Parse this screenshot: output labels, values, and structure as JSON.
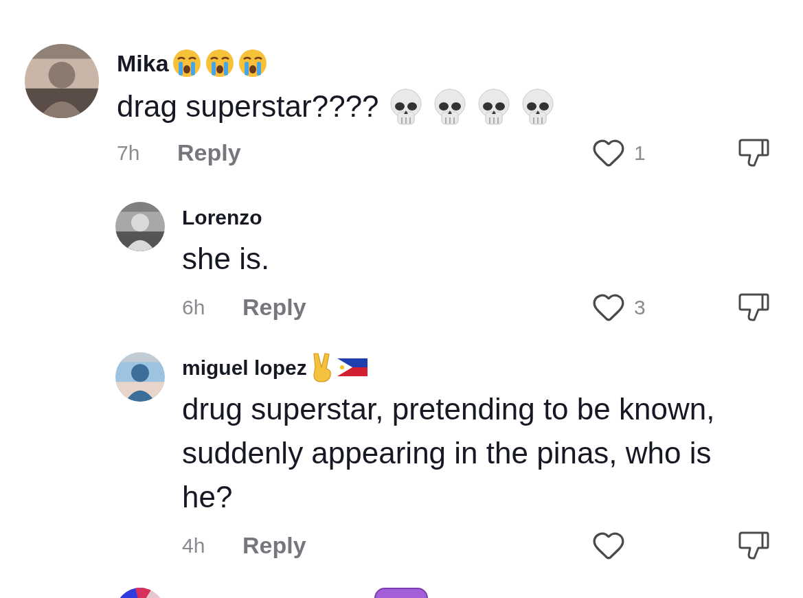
{
  "comments": [
    {
      "username": "Mika",
      "name_icons": [
        {
          "kind": "crying-face"
        },
        {
          "kind": "crying-face"
        },
        {
          "kind": "crying-face"
        }
      ],
      "text": "drag superstar????",
      "text_icons": [
        {
          "kind": "skull"
        },
        {
          "kind": "skull"
        },
        {
          "kind": "skull"
        },
        {
          "kind": "skull"
        }
      ],
      "time": "7h",
      "reply_label": "Reply",
      "liked": false,
      "likes": "1",
      "replies": [
        {
          "username": "Lorenzo",
          "text": "she is.",
          "time": "6h",
          "reply_label": "Reply",
          "liked": false,
          "likes": "3"
        },
        {
          "username": "miguel lopez",
          "name_icons": [
            {
              "kind": "peace-hand"
            },
            {
              "kind": "flag"
            }
          ],
          "text": "drug superstar, pretending to be known, suddenly appearing in the pinas, who is he?",
          "time": "4h",
          "reply_label": "Reply",
          "liked": false
        }
      ]
    }
  ],
  "next_comment": {
    "name_icons": [
      {
        "kind": "purple-badge"
      }
    ]
  }
}
